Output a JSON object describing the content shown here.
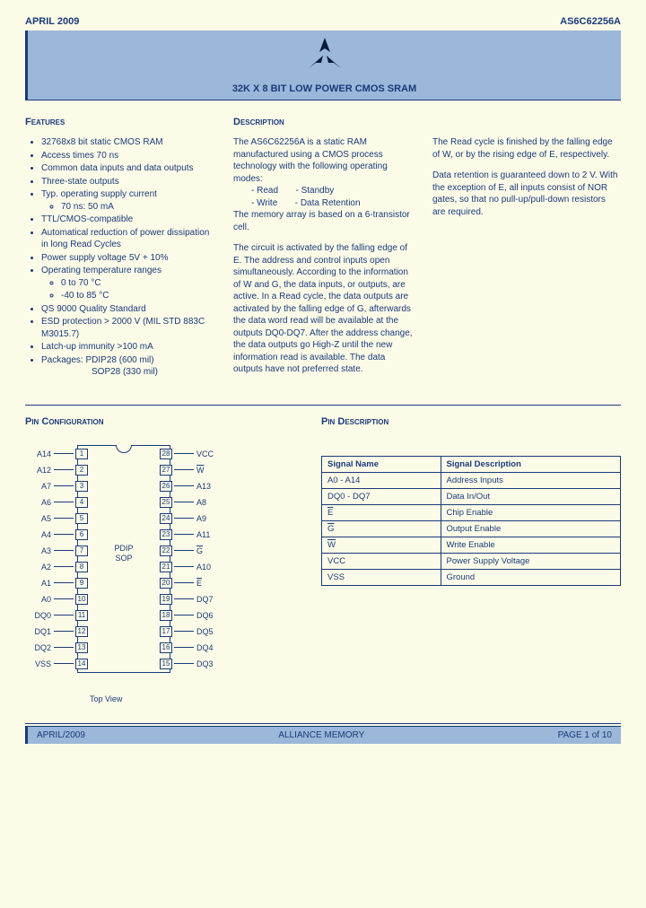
{
  "meta": {
    "date": "APRIL 2009",
    "part_number": "AS6C62256A",
    "title": "32K X 8 BIT LOW POWER CMOS SRAM",
    "footer_date": "APRIL/2009",
    "footer_company": "ALLIANCE MEMORY",
    "footer_page": "PAGE 1 of 10"
  },
  "headings": {
    "features": "Features",
    "description": "Description",
    "pin_configuration": "Pin Configuration",
    "pin_description": "Pin Description"
  },
  "features": [
    "32768x8 bit static CMOS RAM",
    "Access times 70 ns",
    "Common data inputs and data outputs",
    "Three-state outputs",
    "Typ. operating supply current",
    "TTL/CMOS-compatible",
    "Automatical reduction of power dissipation in long Read Cycles",
    "Power supply voltage 5V + 10%",
    "Operating temperature ranges",
    "QS 9000 Quality Standard",
    "ESD protection > 2000 V (MIL STD 883C M3015.7)",
    "Latch-up immunity >100 mA",
    "Packages:  PDIP28 (600 mil)"
  ],
  "feature_sub_supply": "70 ns: 50 mA",
  "feature_sub_temp1": "0 to 70 °C",
  "feature_sub_temp2": "-40 to 85 °C",
  "feature_pkg2": "SOP28 (330 mil)",
  "description": {
    "p1a": "The AS6C62256A is a static RAM manufactured using a CMOS process technology with the following operating modes:",
    "mode_read": "- Read",
    "mode_standby": "- Standby",
    "mode_write": "- Write",
    "mode_retention": "- Data Retention",
    "p1b": "The memory array is based on a 6-transistor cell.",
    "p2": "The circuit is activated by the falling edge of E. The address and control inputs open simultaneously. According to the information of W and G, the data inputs, or outputs, are active. In a Read cycle, the data outputs are activated by the falling edge of G, afterwards the data word read will be available at the outputs DQ0-DQ7. After the address change, the data outputs go High-Z until the new information read is available. The data outputs have not preferred state.",
    "p3": "The Read cycle is finished by the falling edge of W, or by the rising edge of E, respectively.",
    "p4": "Data retention is guaranteed down to 2 V. With the exception of E, all inputs consist of NOR gates, so that no pull-up/pull-down resistors are required."
  },
  "chip": {
    "label1": "PDIP",
    "label2": "SOP",
    "top_view": "Top View",
    "left": [
      {
        "name": "A14",
        "num": "1"
      },
      {
        "name": "A12",
        "num": "2"
      },
      {
        "name": "A7",
        "num": "3"
      },
      {
        "name": "A6",
        "num": "4"
      },
      {
        "name": "A5",
        "num": "5"
      },
      {
        "name": "A4",
        "num": "6"
      },
      {
        "name": "A3",
        "num": "7"
      },
      {
        "name": "A2",
        "num": "8"
      },
      {
        "name": "A1",
        "num": "9"
      },
      {
        "name": "A0",
        "num": "10"
      },
      {
        "name": "DQ0",
        "num": "11"
      },
      {
        "name": "DQ1",
        "num": "12"
      },
      {
        "name": "DQ2",
        "num": "13"
      },
      {
        "name": "VSS",
        "num": "14"
      }
    ],
    "right": [
      {
        "name": "VCC",
        "num": "28"
      },
      {
        "name": "W",
        "num": "27",
        "over": true
      },
      {
        "name": "A13",
        "num": "26"
      },
      {
        "name": "A8",
        "num": "25"
      },
      {
        "name": "A9",
        "num": "24"
      },
      {
        "name": "A11",
        "num": "23"
      },
      {
        "name": "G",
        "num": "22",
        "over": true
      },
      {
        "name": "A10",
        "num": "21"
      },
      {
        "name": "E",
        "num": "20",
        "over": true
      },
      {
        "name": "DQ7",
        "num": "19"
      },
      {
        "name": "DQ6",
        "num": "18"
      },
      {
        "name": "DQ5",
        "num": "17"
      },
      {
        "name": "DQ4",
        "num": "16"
      },
      {
        "name": "DQ3",
        "num": "15"
      }
    ]
  },
  "pin_table": {
    "h1": "Signal Name",
    "h2": "Signal Description",
    "rows": [
      {
        "n": "A0 - A14",
        "d": "Address Inputs"
      },
      {
        "n": "DQ0 - DQ7",
        "d": "Data In/Out"
      },
      {
        "n": "E",
        "d": "Chip Enable",
        "over": true
      },
      {
        "n": "G",
        "d": "Output Enable",
        "over": true
      },
      {
        "n": "W",
        "d": "Write Enable",
        "over": true
      },
      {
        "n": "VCC",
        "d": "Power Supply Voltage"
      },
      {
        "n": "VSS",
        "d": "Ground"
      }
    ]
  }
}
